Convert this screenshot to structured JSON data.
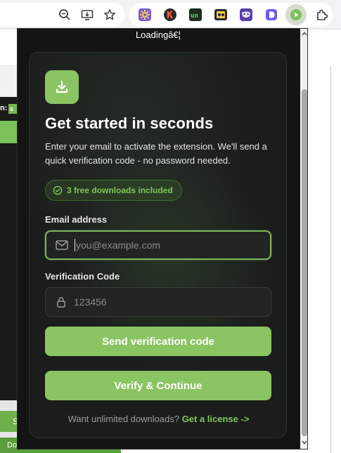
{
  "browser": {
    "icons": [
      "zoom-out-icon",
      "install-app-icon",
      "bookmark-star-icon"
    ],
    "extensions": [
      {
        "name": "gear-extension-icon",
        "color": "#7b5cd6"
      },
      {
        "name": "k-extension-icon",
        "letter": "K",
        "color": "#2b2b2b",
        "accent": "#ff5a3c"
      },
      {
        "name": "terminal-extension-icon",
        "letter": "un",
        "color": "#1d2d1d",
        "accent": "#58e05a"
      },
      {
        "name": "tickets-extension-icon",
        "color": "#2b2b2b"
      },
      {
        "name": "mask-extension-icon",
        "color": "#5b3fa8"
      },
      {
        "name": "d-extension-icon",
        "letter": "D",
        "color": "#6b5cf0"
      },
      {
        "name": "active-download-extension-icon",
        "color": "#7cc15a"
      },
      {
        "name": "puzzle-extensions-icon"
      }
    ]
  },
  "background_page": {
    "left_label": "n:",
    "left_tag": "s",
    "left_button": "S",
    "left_button2": "Do"
  },
  "popup": {
    "loading_text": "Loadingâ€¦",
    "card": {
      "heading": "Get started in seconds",
      "subtext": "Enter your email to activate the extension. We'll send a quick verification code - no password needed.",
      "pill_text": "3 free downloads included",
      "email": {
        "label": "Email address",
        "placeholder": "you@example.com",
        "value": ""
      },
      "code": {
        "label": "Verification Code",
        "placeholder": "123456",
        "value": ""
      },
      "send_button": "Send verification code",
      "verify_button": "Verify & Continue",
      "footer_text": "Want unlimited downloads?",
      "footer_link": "Get a license ->"
    }
  },
  "colors": {
    "accent": "#8bc462",
    "accent_text": "#7fc45a",
    "card_bg": "#1b1d1c",
    "popup_bg": "#141414"
  }
}
